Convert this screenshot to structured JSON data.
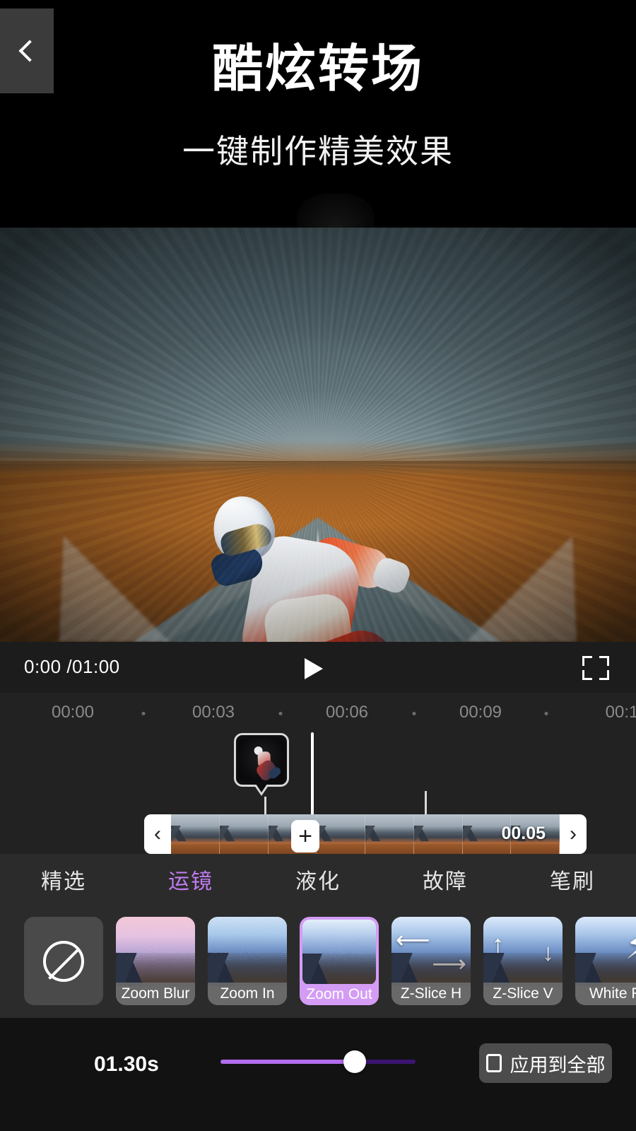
{
  "header": {
    "title": "酷炫转场",
    "subtitle": "一键制作精美效果"
  },
  "player": {
    "time_current": "0:00 /01:00",
    "play_icon": "play-icon",
    "fullscreen_icon": "fullscreen-icon"
  },
  "timeline": {
    "ruler_labels": [
      "00:00",
      "00:03",
      "00:06",
      "00:09",
      "00:1"
    ],
    "clip_duration": "00.05",
    "transition_add_label": "+",
    "scroll_left_icon": "‹",
    "scroll_right_icon": "›"
  },
  "tabs": [
    {
      "label": "精选",
      "active": false
    },
    {
      "label": "运镜",
      "active": true
    },
    {
      "label": "液化",
      "active": false
    },
    {
      "label": "故障",
      "active": false
    },
    {
      "label": "笔刷",
      "active": false
    }
  ],
  "effects": [
    {
      "label": "",
      "kind": "none",
      "selected": false
    },
    {
      "label": "Zoom Blur",
      "kind": "sunset",
      "selected": false
    },
    {
      "label": "Zoom In",
      "kind": "blue",
      "selected": false
    },
    {
      "label": "Zoom Out",
      "kind": "blue2",
      "selected": true
    },
    {
      "label": "Z-Slice H",
      "kind": "arrows-h",
      "selected": false
    },
    {
      "label": "Z-Slice V",
      "kind": "arrows-v",
      "selected": false
    },
    {
      "label": "White F",
      "kind": "bolt",
      "selected": false
    }
  ],
  "bottom": {
    "back_icon": "back-chevron-icon",
    "duration_value": "01.30s",
    "slider_percent": 69,
    "apply_all_label": "应用到全部",
    "apply_all_checked": false
  },
  "colors": {
    "accent": "#b06ced",
    "accent_light": "#d49cf5",
    "panel": "#2b2b2b",
    "bar": "#1c1c1c",
    "bottom": "#121212"
  }
}
